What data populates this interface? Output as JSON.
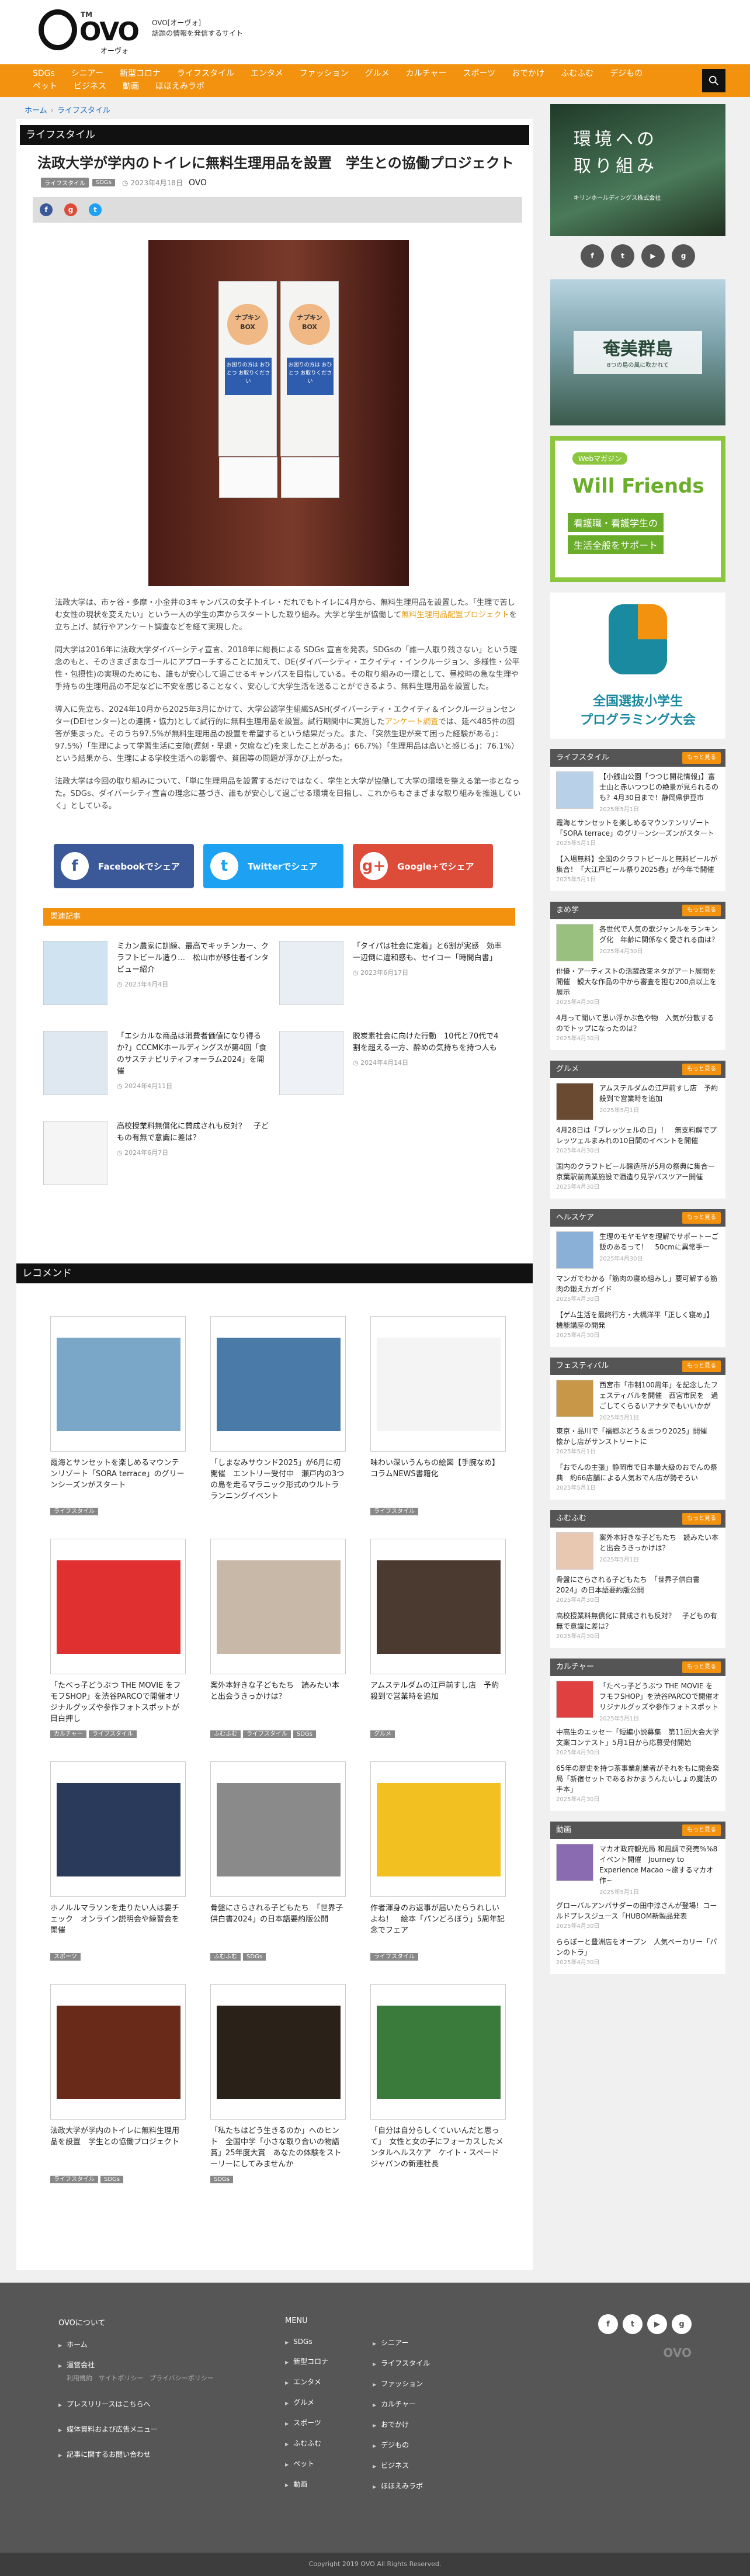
{
  "header": {
    "logo_text": "OVO",
    "logo_tm": "TM",
    "logo_kana": "オーヴォ",
    "site_name": "OVO[オーヴォ]",
    "site_tagline": "話題の情報を発信するサイト"
  },
  "nav": {
    "items": [
      "SDGs",
      "シニアー",
      "新型コロナ",
      "ライフスタイル",
      "エンタメ",
      "ファッション",
      "グルメ",
      "カルチャー",
      "スポーツ",
      "おでかけ",
      "ふむふむ",
      "デジもの",
      "ペット",
      "ビジネス",
      "動画",
      "ほほえみラボ"
    ]
  },
  "breadcrumb": {
    "home": "ホーム",
    "current": "ライフスタイル"
  },
  "article": {
    "category": "ライフスタイル",
    "title": "法政大学が学内のトイレに無料生理用品を設置　学生との協働プロジェクト",
    "tags": [
      "ライフスタイル",
      "SDGs"
    ],
    "date": "2023年4月18日",
    "author": "OVO",
    "hero_labels": {
      "box": "ナプキン BOX",
      "help": "お困りの方は おひとつ お取りください"
    },
    "p1": "法政大学は、市ヶ谷・多摩・小金井の3キャンパスの女子トイレ・だれでもトイレに4月から、無料生理用品を設置した。「生理で苦しむ女性の現状を変えたい」という一人の学生の声からスタートした取り組み。大学と学生が協働して",
    "p1_link": "無料生理用品配置プロジェクト",
    "p1_end": "を立ち上げ、試行やアンケート調査などを経て実現した。",
    "p2": "同大学は2016年に法政大学ダイバーシティ宣言、2018年に総長による SDGs 宣言を発表。SDGsの「誰一人取り残さない」という理念のもと、そのさまざまなゴールにアプローチすることに加えて、DE(ダイバーシティ・エクイティ・インクルージョン、多様性・公平性・包摂性)の実現のためにも、誰もが安心して過ごせるキャンパスを目指している。その取り組みの一環として、昼校時の急な生理や手持ちの生理用品の不足などに不安を感じることなく、安心して大学生活を送ることができるよう、無料生理用品を設置した。",
    "p3a": "導入に先立ち、2024年10月から2025年3月にかけて、大学公認学生組織SASH(ダイバーシティ・エクイティ＆インクルージョンセンター(DEIセンター)との連携・協力)として試行的に無料生理用品を設置。試行期間中に実施した",
    "p3_link": "アンケート調査",
    "p3b": "では、延べ485件の回答が集まった。そのうち97.5%が無料生理用品の設置を希望するという結果だった。また、「突然生理が来て困った経験がある」：97.5%）「生理によって学習生活に支障(遅刻・早退・欠席など)を来したことがある」：66.7%）「生理用品は高いと感じる」：76.1%）という結果から、生理による学校生活への影響や、貧困等の問題が浮かび上がった。",
    "p4": "法政大学は今回の取り組みについて、「単に生理用品を設置するだけではなく、学生と大学が協働して大学の環境を整える第一歩となった。SDGs、ダイバーシティ宣言の理念に基づき、誰もが安心して過ごせる環境を目指し、これからもさまざまな取り組みを推進していく」としている。",
    "share": {
      "facebook": "Facebookでシェア",
      "twitter": "Twitterでシェア",
      "google": "Google+でシェア"
    }
  },
  "related": {
    "heading": "関連記事",
    "items": [
      {
        "title": "ミカン農家に訓練、最高でキッチンカー、クラフトビール造り…　松山市が移住者インタビュー紹介",
        "date": "2023年4月4日"
      },
      {
        "title": "「タイパは社会に定着」と6割が実感　効率一辺倒に違和感も、セイコー「時間白書」",
        "date": "2023年6月17日"
      },
      {
        "title": "「エシカルな商品は消費者価値になり得るか?」CCCMKホールディングスが第4回「食のサステナビリティフォーラム2024」を開催",
        "date": "2024年4月11日"
      },
      {
        "title": "脱炭素社会に向けた行動　10代と70代で4割を超える一方、酔めの気持ちを持つ人も",
        "date": "2024年4月14日"
      },
      {
        "title": "高校授業料無償化に賛成されも反対？　子どもの有無で意識に差は？",
        "date": "2024年6月7日"
      }
    ]
  },
  "recommend": {
    "heading": "レコメンド",
    "cards": [
      {
        "title": "霞海とサンセットを楽しめるマウンテンリゾート「SORA terrace」のグリーンシーズンがスタート",
        "tags": [
          "ライフスタイル"
        ]
      },
      {
        "title": "「しまなみサウンド2025」が6月に初開催　エントリー受付中　瀬戸内の3つの島を走るマラニック形式のウルトラランニングイベント",
        "tags": []
      },
      {
        "title": "味わい深いうんちの絵図【手腕なめ】コラムNEWS書籍化",
        "tags": [
          "ライフスタイル"
        ]
      },
      {
        "title": "「たべっ子どうぶつ THE MOVIE をフモフSHOP」を渋谷PARCOで開催オリジナルグッズや参作フォトスポットが目白押し",
        "tags": [
          "カルチャー",
          "ライフスタイル"
        ]
      },
      {
        "title": "案外本好きな子どもたち　読みたい本と出会うきっかけは？",
        "tags": [
          "ふむふむ",
          "ライフスタイル",
          "SDGs"
        ]
      },
      {
        "title": "アムステルダムの江戸前すし店　予約殺到で営業時を追加",
        "tags": [
          "グルメ"
        ]
      },
      {
        "title": "ホノルルマラソンを走りたい人は要チェック　オンライン説明会や練習会を開催",
        "tags": [
          "スポーツ"
        ]
      },
      {
        "title": "骨盤にさらされる子どもたち　「世界子供白書2024」の日本語要約版公開",
        "tags": [
          "ふむふむ",
          "SDGs"
        ]
      },
      {
        "title": "作者渾身のお返事が届いたらうれしいよね！　絵本「パンどろぼう」5周年記念でフェア",
        "tags": [
          "ライフスタイル"
        ]
      },
      {
        "title": "法政大学が学内のトイレに無料生理用品を設置　学生との協働プロジェクト",
        "tags": [
          "ライフスタイル",
          "SDGs"
        ]
      },
      {
        "title": "「私たちはどう生きるのか」へのヒント　全国中学「小さな取り合いの物語賞」25年度大賞　あなたの体験をストーリーにしてみませんか",
        "tags": [
          "SDGs"
        ]
      },
      {
        "title": "「自分は自分らしくていいんだと思って」　女性と女の子にフォーカスしたメンタルヘルスケア　ケイト・スペード ジャパンの新連社長",
        "tags": []
      }
    ]
  },
  "sidebar": {
    "ad1": {
      "title1": "環境への",
      "title2": "取り組み",
      "sub": "キリンホールディングス株式会社"
    },
    "ad2": {
      "title": "奄美群島",
      "sub": "8つの島の風に吹かれて"
    },
    "ad3": {
      "tag": "Webマガジン",
      "title": "Will Friends",
      "sub1": "看護職・看護学生の",
      "sub2": "生活全般をサポート"
    },
    "ad4": {
      "title1": "全国選抜小学生",
      "title2": "プログラミング大会"
    },
    "more_label": "もっと見る",
    "widgets": [
      {
        "name": "ライフスタイル",
        "items": [
          {
            "title": "【小銭山公園「つつじ開花情報」】富士山と赤いつつじの絶景が見られるのも？4月30日まで！静岡県伊豆市",
            "date": "2025年5月1日",
            "thumb": true
          },
          {
            "title": "霞海とサンセットを楽しめるマウンテンリゾート「SORA terrace」のグリーンシーズンがスタート",
            "date": "2025年5月1日",
            "thumb": false
          },
          {
            "title": "【入場無料】全国のクラフトビールと無料ビールが集合！「大江戸ビール祭り2025春」が今年で開催",
            "date": "2025年5月1日",
            "thumb": false
          }
        ]
      },
      {
        "name": "まめ学",
        "items": [
          {
            "title": "各世代で人気の歌ジャンルをランキング化　年齢に関係なく愛される曲は？",
            "date": "2025年4月30日",
            "thumb": true
          },
          {
            "title": "俳優・アーティストの活躍改変ネタがアート展開を開催　観大な作品の中から審査を担む200点以上を展示",
            "date": "2025年4月30日",
            "thumb": false
          },
          {
            "title": "4月って聞いて思い浮かぶ色や物　入気が分散するのでトップになったのは？",
            "date": "2025年4月30日",
            "thumb": false
          }
        ]
      },
      {
        "name": "グルメ",
        "items": [
          {
            "title": "アムステルダムの江戸前すし店　予約殺到で営業時を追加",
            "date": "2025年5月1日",
            "thumb": true
          },
          {
            "title": "4月28日は「ブレッツェルの日」！　無支料解でプレッツェルまみれの10日間のイベントを開催",
            "date": "2025年4月30日",
            "thumb": false
          },
          {
            "title": "国内のクラフトビール醸造所が5月の祭典に集合ー　京葉駅前商業施設で酒造り見学バスツアー開催",
            "date": "2025年4月30日",
            "thumb": false
          }
        ]
      },
      {
        "name": "ヘルスケア",
        "items": [
          {
            "title": "生理のモヤモヤを理解でサポートーご飯のあるって！　50cmに異常手ー",
            "date": "2025年4月30日",
            "thumb": true
          },
          {
            "title": "マンガでわかる「筋肉の寝め組みし」要可解する筋肉の鍛え方ガイド",
            "date": "2025年4月30日",
            "thumb": false
          },
          {
            "title": "【ゲム生活を最終行方・大橋洋平「正しく寝め」】機能講座の開発",
            "date": "2025年4月30日",
            "thumb": false
          }
        ]
      },
      {
        "name": "フェスティバル",
        "items": [
          {
            "title": "西宮市「市制100周年」を記念したフェスティバルを開催　西宮市民を　過ごしてくらるいアナタでもいいかが",
            "date": "2025年5月1日",
            "thumb": true
          },
          {
            "title": "東京・品川で「福郷ぶどう＆まつり2025」開催　懐かし店がサンストリートに",
            "date": "2025年5月1日",
            "thumb": false
          },
          {
            "title": "「おでんの主張」静岡市で日本最大級のおでんの祭典　約66店舗による人気おでん店が勢ぞろい",
            "date": "2025年5月1日",
            "thumb": false
          }
        ]
      },
      {
        "name": "ふむふむ",
        "items": [
          {
            "title": "案外本好きな子どもたち　読みたい本と出会うきっかけは？",
            "date": "2025年5月1日",
            "thumb": true
          },
          {
            "title": "骨盤にさらされる子どもたち　「世界子供白書2024」の日本語要約版公開",
            "date": "2025年4月30日",
            "thumb": false
          },
          {
            "title": "高校授業料無償化に賛成されも反対？　子どもの有無で意識に差は？",
            "date": "2025年4月30日",
            "thumb": false
          }
        ]
      },
      {
        "name": "カルチャー",
        "items": [
          {
            "title": "「たべっ子どうぶつ THE MOVIE をフモフSHOP」を渋谷PARCOで開催オリジナルグッズや参作フォトスポット",
            "date": "2025年5月1日",
            "thumb": true
          },
          {
            "title": "中高生のエッセー「短編小説募集　第11回大会大学文案コンテスト」5月1日から応募受付開始",
            "date": "2025年4月30日",
            "thumb": false
          },
          {
            "title": "65年の歴史を持つ茶事業創業者がそれをもに開会楽局「新宿セットであるおかまうんたいしょの魔法の手本」",
            "date": "2025年4月30日",
            "thumb": false
          }
        ]
      },
      {
        "name": "動画",
        "items": [
          {
            "title": "マカオ政府観光局 和風調で発売%%8イベント開催　Journey to Experience Macao ~旅するマカオ作~",
            "date": "2025年5月1日",
            "thumb": true
          },
          {
            "title": "グローバルアンバサダーの田中淳さんが登場！コールドプレスジュース「HUBOM新製品発表",
            "date": "2025年4月30日",
            "thumb": false
          },
          {
            "title": "ららぽーと豊洲店をオープン　人気ベーカリー「パンのトラ」",
            "date": "2025年4月30日",
            "thumb": false
          }
        ]
      }
    ]
  },
  "footer": {
    "about_title": "OVOについて",
    "about_links": [
      "ホーム",
      "運営会社",
      "プレスリリースはこちらへ",
      "媒体資料および広告メニュー",
      "記事に関するお問い合わせ"
    ],
    "about_sub": [
      "利用規約",
      "サイトポリシー",
      "プライバシーポリシー"
    ],
    "menu_title": "MENU",
    "menu_col1": [
      "SDGs",
      "新型コロナ",
      "エンタメ",
      "グルメ",
      "スポーツ",
      "ふむふむ",
      "ペット",
      "動画"
    ],
    "menu_col2": [
      "シニアー",
      "ライフスタイル",
      "ファッション",
      "カルチャー",
      "おでかけ",
      "デジもの",
      "ビジネス",
      "ほほえみラボ"
    ],
    "copyright": "Copyright 2019 OVO All Rights Reserved."
  },
  "colors": {
    "accent": "#f2920f",
    "dark": "#111111",
    "footer": "#565656",
    "facebook": "#3b5998",
    "twitter": "#1da1f2",
    "google": "#dd4b39"
  }
}
